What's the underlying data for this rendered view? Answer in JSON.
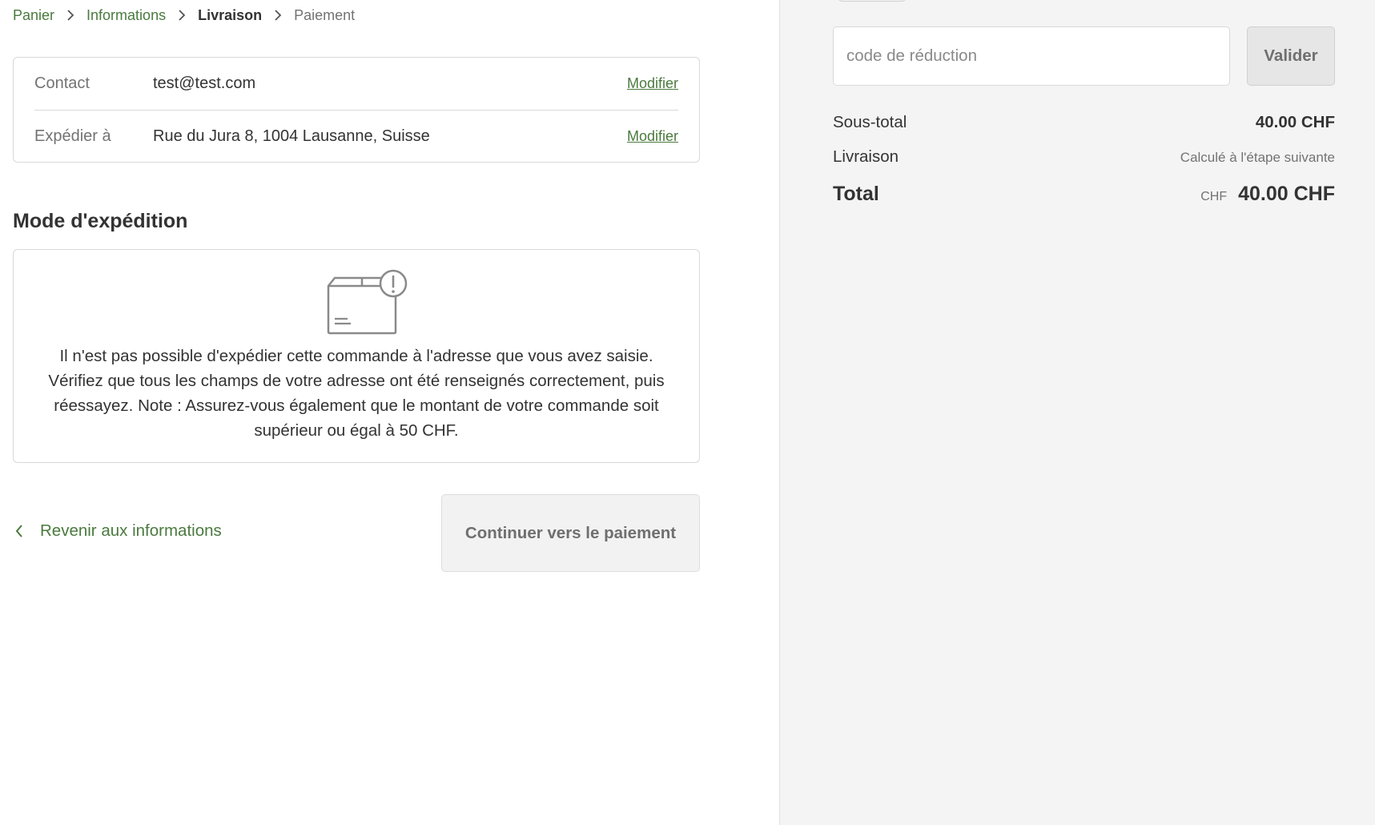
{
  "breadcrumb": {
    "items": [
      {
        "label": "Panier"
      },
      {
        "label": "Informations"
      },
      {
        "label": "Livraison"
      },
      {
        "label": "Paiement"
      }
    ]
  },
  "review": {
    "contact_label": "Contact",
    "contact_value": "test@test.com",
    "contact_action": "Modifier",
    "ship_label": "Expédier à",
    "ship_value": "Rue du Jura 8, 1004 Lausanne, Suisse",
    "ship_action": "Modifier"
  },
  "shipping_method": {
    "title": "Mode d'expédition",
    "icon": "package-warning-icon",
    "message": "Il n'est pas possible d'expédier cette commande à l'adresse que vous avez saisie. Vérifiez que tous les champs de votre adresse ont été renseignés correctement, puis réessayez. Note : Assurez-vous également que le montant de votre commande soit supérieur ou égal à 50 CHF."
  },
  "footer": {
    "back_label": "Revenir aux informations",
    "continue_label": "Continuer vers le paiement"
  },
  "summary": {
    "discount_placeholder": "code de réduction",
    "apply_label": "Valider",
    "subtotal_label": "Sous-total",
    "subtotal_value": "40.00 CHF",
    "shipping_label": "Livraison",
    "shipping_value": "Calculé à l'étape suivante",
    "total_label": "Total",
    "total_currency": "CHF",
    "total_value": "40.00 CHF"
  },
  "colors": {
    "accent": "#4a7a3e",
    "sidebar_bg": "#f4f4f4",
    "border": "#d9d9d9"
  }
}
